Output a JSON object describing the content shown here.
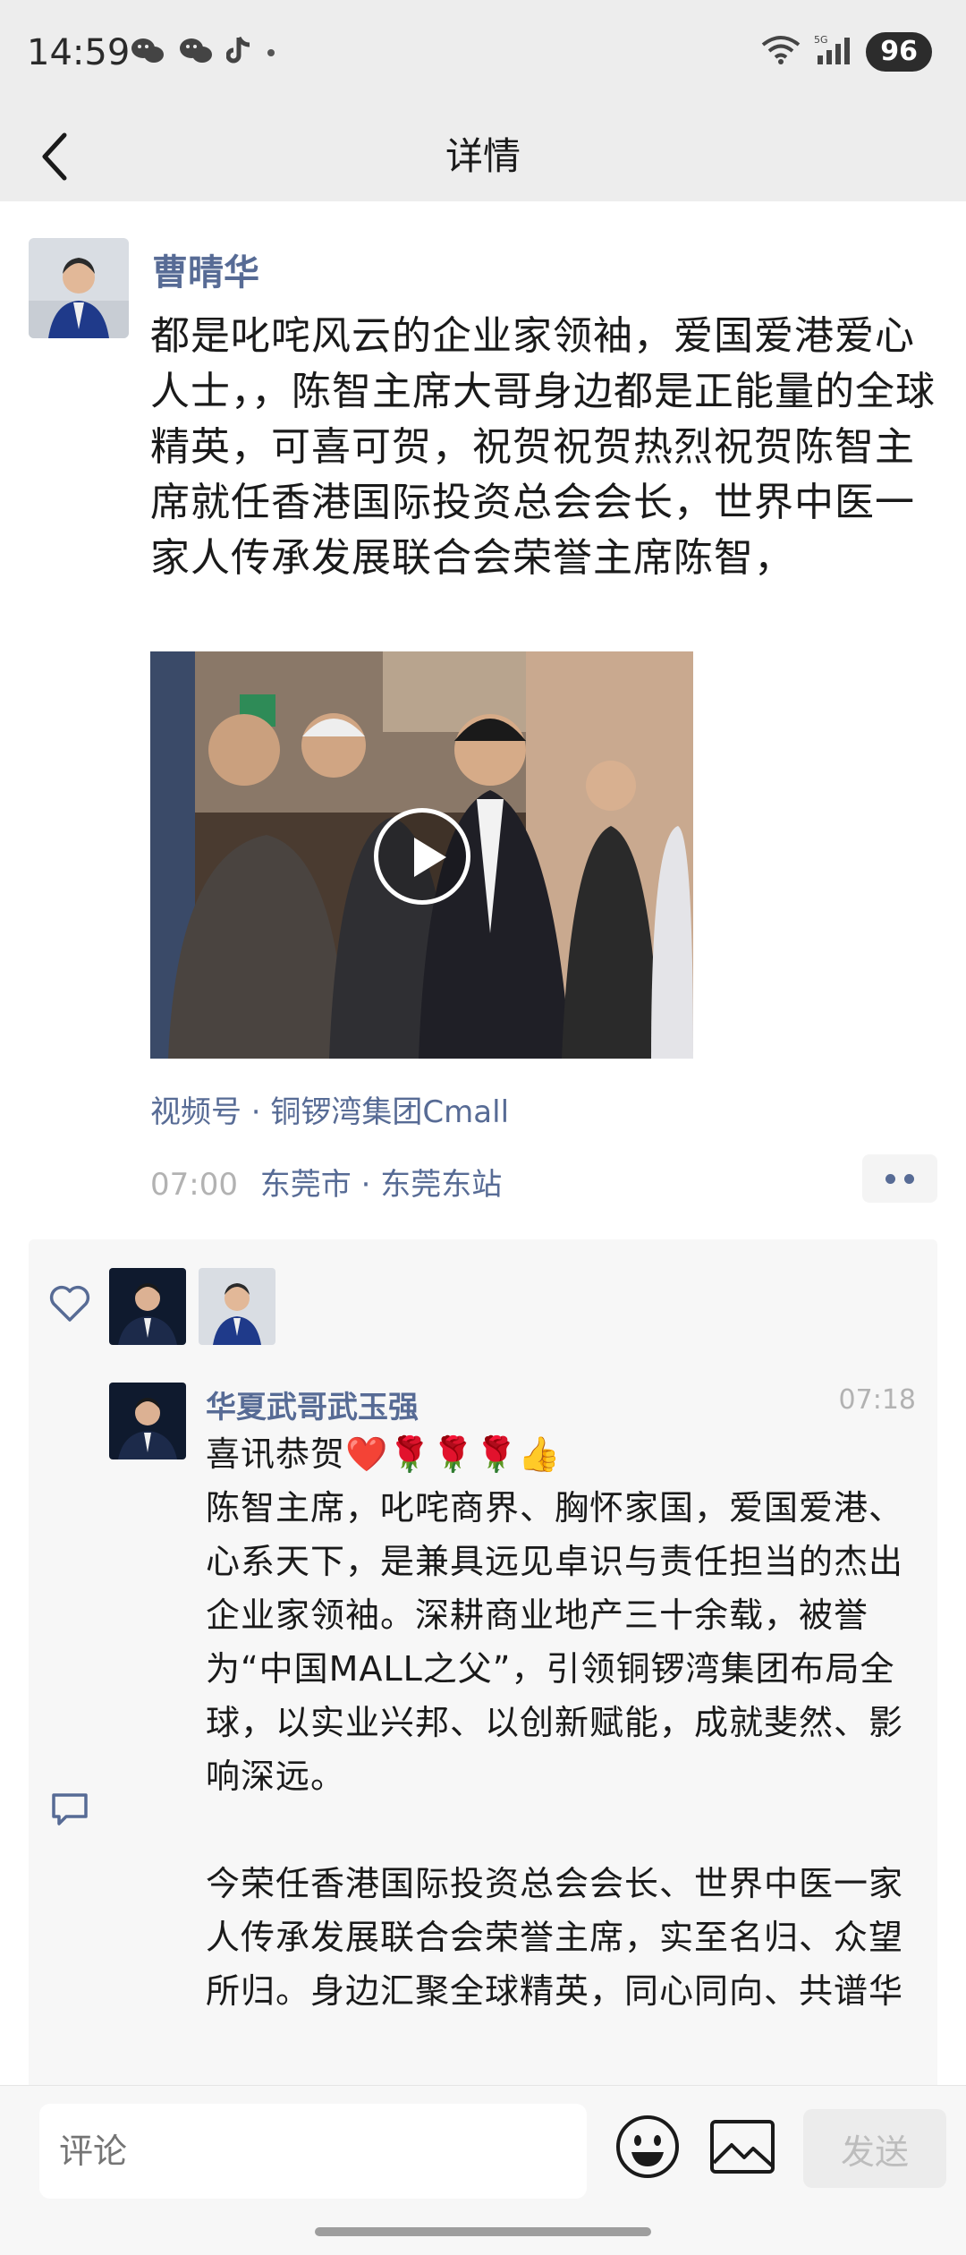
{
  "status_bar": {
    "time": "14:59",
    "battery": "96",
    "signal_label": "5G"
  },
  "nav": {
    "title": "详情"
  },
  "post": {
    "author": "曹晴华",
    "text": "都是叱咤风云的企业家领袖，爱国爱港爱心人士，，陈智主席大哥身边都是正能量的全球精英，可喜可贺，祝贺祝贺热烈祝贺陈智主席就任香港国际投资总会会长，世界中医一家人传承发展联合会荣誉主席陈智，",
    "channel": "视频号 · 铜锣湾集团Cmall",
    "time": "07:00",
    "location": "东莞市 · 东莞东站"
  },
  "comment": {
    "author": "华夏武哥武玉强",
    "time": "07:18",
    "paragraphs": [
      "喜讯恭贺❤️🌹🌹🌹👍",
      "陈智主席，叱咤商界、胸怀家国，爱国爱港、心系天下，是兼具远见卓识与责任担当的杰出企业家领袖。深耕商业地产三十余载，被誉为“中国MALL之父”，引领铜锣湾集团布局全球，以实业兴邦、以创新赋能，成就斐然、影响深远。",
      "今荣任香港国际投资总会会长、世界中医一家人传承发展联合会荣誉主席，实至名归、众望所归。身边汇聚全球精英，同心同向、共谱华"
    ]
  },
  "bottom_bar": {
    "input_placeholder": "评论",
    "send_label": "发送"
  },
  "colors": {
    "link": "#576b95",
    "bar_bg": "#ededed",
    "panel_bg": "#f7f7f7"
  }
}
